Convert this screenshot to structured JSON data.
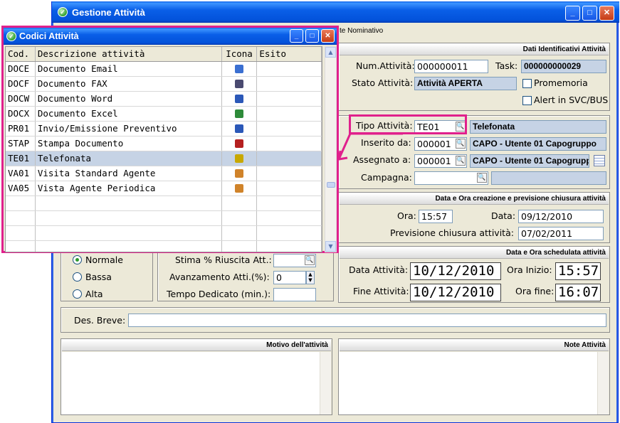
{
  "main_window": {
    "title": "Gestione Attività",
    "tab_partial": "te Nominativo"
  },
  "popup": {
    "title": "Codici Attività",
    "columns": [
      "Cod.",
      "Descrizione attività",
      "Icona",
      "Esito"
    ],
    "rows": [
      {
        "code": "DOCE",
        "desc": "Documento Email",
        "icon": "email-doc-icon",
        "color": "#3a6fd1"
      },
      {
        "code": "DOCF",
        "desc": "Documento FAX",
        "icon": "fax-icon",
        "color": "#4a4a70"
      },
      {
        "code": "DOCW",
        "desc": "Documento Word",
        "icon": "word-doc-icon",
        "color": "#2b58b8"
      },
      {
        "code": "DOCX",
        "desc": "Documento Excel",
        "icon": "excel-doc-icon",
        "color": "#2e8b3a"
      },
      {
        "code": "PR01",
        "desc": "Invio/Emissione Preventivo",
        "icon": "quote-doc-icon",
        "color": "#2b58b8"
      },
      {
        "code": "STAP",
        "desc": "Stampa Documento",
        "icon": "printer-icon",
        "color": "#b52020"
      },
      {
        "code": "TE01",
        "desc": "Telefonata",
        "icon": "phone-icon",
        "color": "#c8a800"
      },
      {
        "code": "VA01",
        "desc": "Visita Standard Agente",
        "icon": "agent-icon",
        "color": "#d0832a"
      },
      {
        "code": "VA05",
        "desc": "Vista Agente Periodica",
        "icon": "agent-icon",
        "color": "#d0832a"
      }
    ],
    "selected_code": "TE01"
  },
  "identificativi": {
    "header": "Dati Identificativi Attività",
    "num_label": "Num.Attività:",
    "num_value": "000000011",
    "task_label": "Task:",
    "task_value": "000000000029",
    "stato_label": "Stato Attività:",
    "stato_value": "Attività APERTA",
    "promemoria_label": "Promemoria",
    "alert_label": "Alert in SVC/BUS"
  },
  "tipo": {
    "tipo_label": "Tipo Attività:",
    "tipo_code": "TE01",
    "tipo_desc": "Telefonata",
    "inserito_label": "Inserito da:",
    "inserito_code": "000001",
    "inserito_desc": "CAPO - Utente 01 Capogruppo",
    "assegnato_label": "Assegnato a:",
    "assegnato_code": "000001",
    "assegnato_desc": "CAPO - Utente 01 Capogrupp",
    "campagna_label": "Campagna:"
  },
  "creazione": {
    "header": "Data e Ora creazione e previsione chiusura attività",
    "ora_label": "Ora:",
    "ora_value": "15:57",
    "data_label": "Data:",
    "data_value": "09/12/2010",
    "prev_label": "Previsione chiusura attività:",
    "prev_value": "07/02/2011"
  },
  "priorita": {
    "normale": "Normale",
    "bassa": "Bassa",
    "alta": "Alta",
    "selected": "Normale"
  },
  "stima": {
    "stima_label": "Stima % Riuscita Att.:",
    "avanz_label": "Avanzamento Atti.(%):",
    "avanz_value": "0",
    "tempo_label": "Tempo Dedicato (min.):"
  },
  "schedulata": {
    "header": "Data e Ora schedulata attività",
    "data_label": "Data Attività:",
    "data_value": "10/12/2010",
    "ora_inizio_label": "Ora Inizio:",
    "ora_inizio_value": "15:57",
    "fine_label": "Fine Attività:",
    "fine_value": "10/12/2010",
    "ora_fine_label": "Ora fine:",
    "ora_fine_value": "16:07"
  },
  "des_breve": {
    "label": "Des. Breve:"
  },
  "motivo": {
    "header": "Motivo dell'attività"
  },
  "note": {
    "header": "Note Attività"
  },
  "accent": "#e0208c"
}
